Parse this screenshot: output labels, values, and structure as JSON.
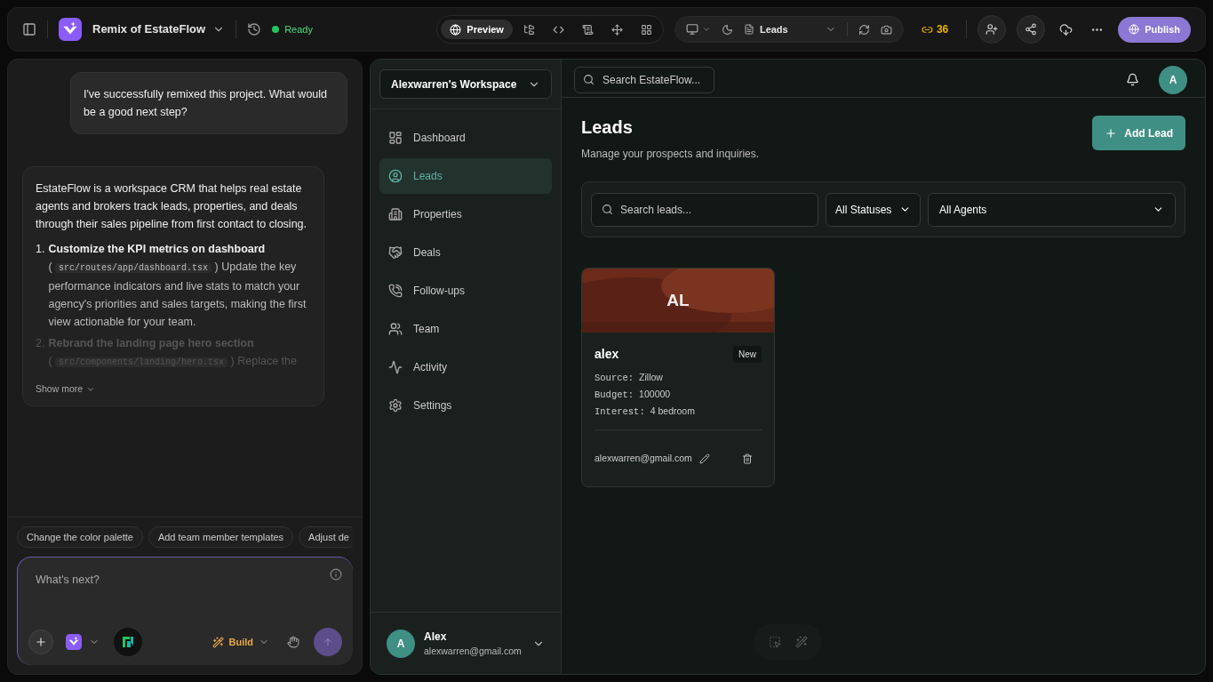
{
  "topbar": {
    "project_name": "Remix of EstateFlow",
    "status": "Ready",
    "view_tabs": [
      {
        "kind": "preview",
        "label": "Preview",
        "selected": true
      },
      {
        "kind": "tree",
        "selected": false
      },
      {
        "kind": "code",
        "selected": false
      },
      {
        "kind": "scroll",
        "selected": false
      },
      {
        "kind": "move",
        "selected": false
      },
      {
        "kind": "grid",
        "selected": false
      }
    ],
    "page": "Leads",
    "credits": "36",
    "publish": "Publish"
  },
  "chat": {
    "user_message": "I've successfully remixed this project. What would be a good next step?",
    "assistant": {
      "intro": "EstateFlow is a workspace CRM that helps real estate agents and brokers track leads, properties, and deals through their sales pipeline from first contact to closing.",
      "steps": [
        {
          "number": "1.",
          "title": "Customize the KPI metrics on dashboard",
          "before": "(",
          "path": "src/routes/app/dashboard.tsx",
          "text": ") Update the key performance indicators and live stats to match your agency's priorities and sales targets, making the first view actionable for your team."
        },
        {
          "number": "2.",
          "title": "Rebrand the landing page hero section",
          "before": "(",
          "path": "src/components/landing/hero.tsx",
          "text": ") Replace the"
        }
      ],
      "show_more": "Show more"
    },
    "suggestions": [
      "Change the color palette",
      "Add team member templates",
      "Adjust de"
    ],
    "composer": {
      "placeholder": "What's next?",
      "mode": "Build"
    }
  },
  "app": {
    "workspace": "Alexwarren's Workspace",
    "nav": [
      {
        "kind": "dashboard",
        "label": "Dashboard",
        "selected": false
      },
      {
        "kind": "leads",
        "label": "Leads",
        "selected": true
      },
      {
        "kind": "properties",
        "label": "Properties",
        "selected": false
      },
      {
        "kind": "deals",
        "label": "Deals",
        "selected": false
      },
      {
        "kind": "followups",
        "label": "Follow-ups",
        "selected": false
      },
      {
        "kind": "team",
        "label": "Team",
        "selected": false
      },
      {
        "kind": "activity",
        "label": "Activity",
        "selected": false
      },
      {
        "kind": "settings",
        "label": "Settings",
        "selected": false
      }
    ],
    "user": {
      "initial": "A",
      "name": "Alex",
      "email": "alexwarren@gmail.com"
    },
    "search_placeholder": "Search EstateFlow...",
    "avatar": "A",
    "title": "Leads",
    "subtitle": "Manage your prospects and inquiries.",
    "add_button": "Add Lead",
    "filters": {
      "search_placeholder": "Search leads...",
      "status": "All Statuses",
      "agent": "All Agents"
    },
    "leads": [
      {
        "initials": "AL",
        "name": "alex",
        "status": "New",
        "fields": [
          {
            "label": "Source:",
            "value": "Zillow"
          },
          {
            "label": "Budget:",
            "value": "100000"
          },
          {
            "label": "Interest:",
            "value": "4 bedroom"
          }
        ],
        "email": "alexwarren@gmail.com"
      }
    ]
  }
}
